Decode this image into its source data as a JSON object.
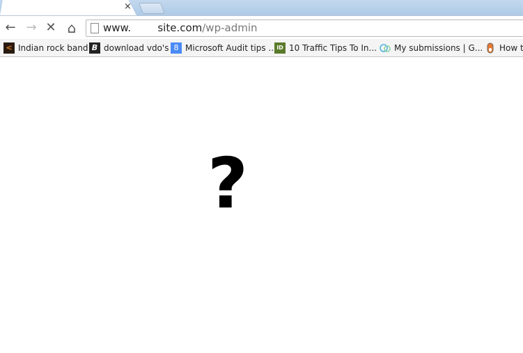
{
  "tab": {
    "close_icon": "×"
  },
  "toolbar": {
    "back_icon": "←",
    "forward_icon": "→",
    "stop_icon": "✕",
    "home_icon": "⌂",
    "url_prefix": "www.        site.com",
    "url_path": "/wp-admin"
  },
  "bookmarks": [
    {
      "label": "Indian rock band",
      "icon": "rock-band-icon"
    },
    {
      "label": "download vdo's",
      "icon": "b-logo-icon"
    },
    {
      "label": "Microsoft Audit tips ...",
      "icon": "google-8-icon"
    },
    {
      "label": "10 Traffic Tips To In...",
      "icon": "id-icon"
    },
    {
      "label": "My submissions | G...",
      "icon": "circles-icon"
    },
    {
      "label": "How to",
      "icon": "pill-icon"
    }
  ],
  "content": {
    "glyph": "?"
  }
}
